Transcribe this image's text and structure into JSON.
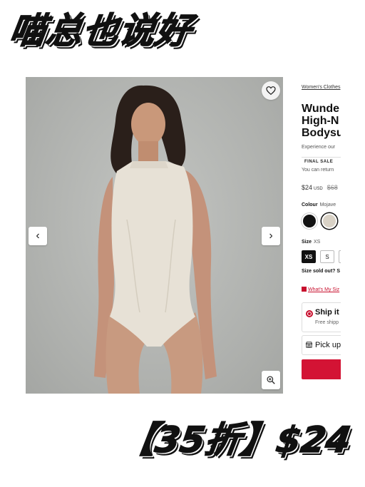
{
  "overlay": {
    "headline": "喵总也说好",
    "deal": "【35折】$24"
  },
  "gallery": {
    "favorite_icon": "heart-outline-icon",
    "prev_icon": "chevron-left-icon",
    "next_icon": "chevron-right-icon",
    "zoom_icon": "zoom-in-icon",
    "prev_glyph": "‹",
    "next_glyph": "›"
  },
  "product": {
    "breadcrumb": "Women's Clothes",
    "title_lines": [
      "Wunde",
      "High-N",
      "Bodysu"
    ],
    "description": "Experience our",
    "badge": "FINAL SALE",
    "return_note": "You can return",
    "price": "$24",
    "currency": "USD",
    "old_price": "$68",
    "colour_label": "Colour",
    "colour_value": "Mojave",
    "swatches": [
      "#111111",
      "#d9d2c6"
    ],
    "size_label": "Size",
    "size_value": "XS",
    "sizes": [
      "XS",
      "S",
      ""
    ],
    "selected_size": "XS",
    "soldout_text": "Size sold out? S",
    "size_guide": "What's My Siz",
    "ship_title": "Ship it",
    "ship_sub": "Free shipp",
    "pickup": "Pick up",
    "accent": "#d31334"
  }
}
